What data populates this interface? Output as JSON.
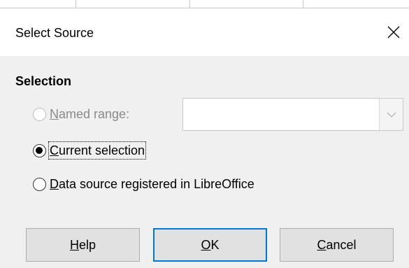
{
  "dialog": {
    "title": "Select Source",
    "close_icon": "close-icon"
  },
  "selection": {
    "label": "Selection",
    "options": [
      {
        "mnemonic": "N",
        "rest": "amed range:",
        "checked": false,
        "enabled": false
      },
      {
        "mnemonic": "C",
        "rest": "urrent selection",
        "checked": true,
        "enabled": true
      },
      {
        "mnemonic": "D",
        "rest": "ata source registered in LibreOffice",
        "checked": false,
        "enabled": true
      }
    ],
    "named_range_value": "",
    "combo_icon": "chevron-down-icon"
  },
  "buttons": {
    "help": {
      "mnemonic": "H",
      "rest": "elp"
    },
    "ok": {
      "mnemonic": "O",
      "rest": "K"
    },
    "cancel": {
      "mnemonic": "C",
      "rest": "ancel"
    }
  },
  "colors": {
    "dialog_bg": "#f0f0f0",
    "titlebar_bg": "#ffffff",
    "default_button_border": "#0078d7",
    "disabled_text": "#8a8a8a"
  }
}
